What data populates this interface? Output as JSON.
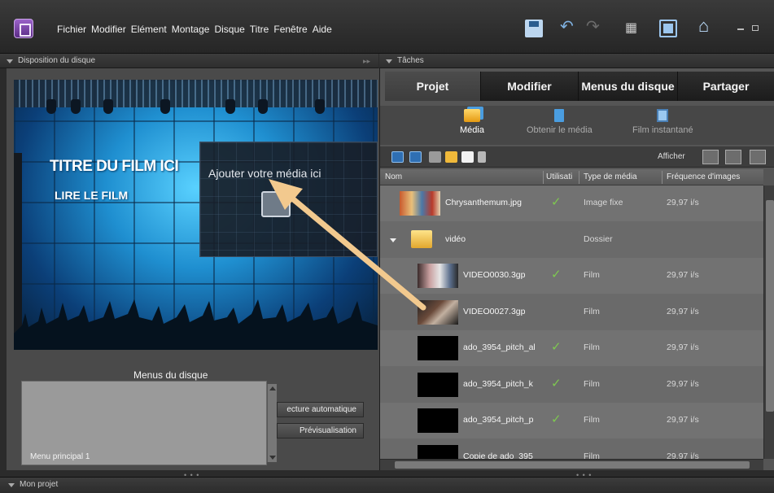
{
  "menu_bar": {
    "items": [
      "Fichier",
      "Modifier",
      "Elément",
      "Montage",
      "Disque",
      "Titre",
      "Fenêtre",
      "Aide"
    ]
  },
  "toolbar_icons": [
    "save-icon",
    "undo-icon",
    "redo-icon",
    "layout-icon",
    "fullscreen-icon",
    "home-icon"
  ],
  "left_panel": {
    "header": "Disposition du disque",
    "preview": {
      "title_text": "TITRE DU FILM ICI",
      "play_text": "LIRE LE FILM",
      "media_placeholder": "Ajouter votre média ici"
    },
    "menus_label": "Menus du disque",
    "menu_thumb_label": "Menu principal 1",
    "buttons": {
      "autoplay": "ecture automatique",
      "preview": "Prévisualisation"
    }
  },
  "right_panel": {
    "header": "Tâches",
    "tabs": [
      "Projet",
      "Modifier",
      "Menus du disque",
      "Partager"
    ],
    "active_tab": "Projet",
    "subtabs": [
      "Média",
      "Obtenir le média",
      "Film instantané"
    ],
    "active_subtab": "Média",
    "show_label": "Afficher",
    "columns": [
      "Nom",
      "Utilisati",
      "Type de média",
      "Fréquence d'images"
    ],
    "rows": [
      {
        "name": "Chrysanthemum.jpg",
        "used": true,
        "type": "Image fixe",
        "fps": "29,97 i/s",
        "kind": "image"
      },
      {
        "name": "vidéo",
        "used": false,
        "type": "Dossier",
        "fps": "",
        "kind": "folder"
      },
      {
        "name": "VIDEO0030.3gp",
        "used": true,
        "type": "Film",
        "fps": "29,97 i/s",
        "kind": "video1"
      },
      {
        "name": "VIDEO0027.3gp",
        "used": false,
        "type": "Film",
        "fps": "29,97 i/s",
        "kind": "video2"
      },
      {
        "name": "ado_3954_pitch_al",
        "used": true,
        "type": "Film",
        "fps": "29,97 i/s",
        "kind": "black"
      },
      {
        "name": "ado_3954_pitch_k",
        "used": true,
        "type": "Film",
        "fps": "29,97 i/s",
        "kind": "black"
      },
      {
        "name": "ado_3954_pitch_p",
        "used": true,
        "type": "Film",
        "fps": "29,97 i/s",
        "kind": "black"
      },
      {
        "name": "Copie de ado_395",
        "used": false,
        "type": "Film",
        "fps": "29,97 i/s",
        "kind": "black"
      }
    ]
  },
  "bottom_bar": {
    "label": "Mon projet"
  },
  "colors": {
    "accent_blue": "#4a9de0",
    "check_green": "#7ec850",
    "arrow": "#f2c98e"
  }
}
